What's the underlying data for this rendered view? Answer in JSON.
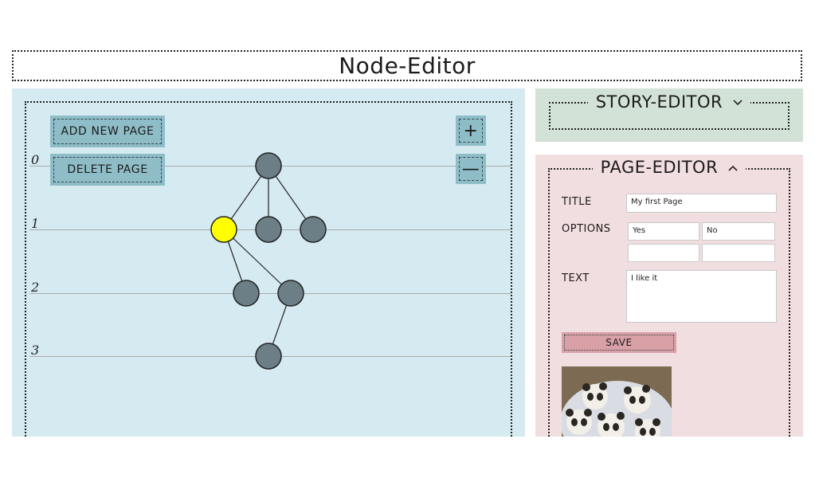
{
  "header": {
    "title": "Node-Editor"
  },
  "node_editor": {
    "buttons": {
      "add_page": "Add new page",
      "delete_page": "Delete page",
      "zoom_in": "+",
      "zoom_out": "—"
    },
    "levels": [
      "0",
      "1",
      "2",
      "3"
    ],
    "selected_node_color": "#ffff00",
    "node_color": "#6c7f86"
  },
  "story_editor": {
    "title": "STORY-EDITOR",
    "chevron": "chevron-down-icon"
  },
  "page_editor": {
    "title": "PAGE-EDITOR",
    "chevron": "chevron-up-icon",
    "title_label": "TITLE",
    "title_value": "My first Page",
    "options_label": "OPTIONS",
    "options": [
      "Yes",
      "No",
      "",
      ""
    ],
    "text_label": "TEXT",
    "text_value": "I like it",
    "save_label": "SAVE",
    "image": "panda-cookies-photo"
  }
}
